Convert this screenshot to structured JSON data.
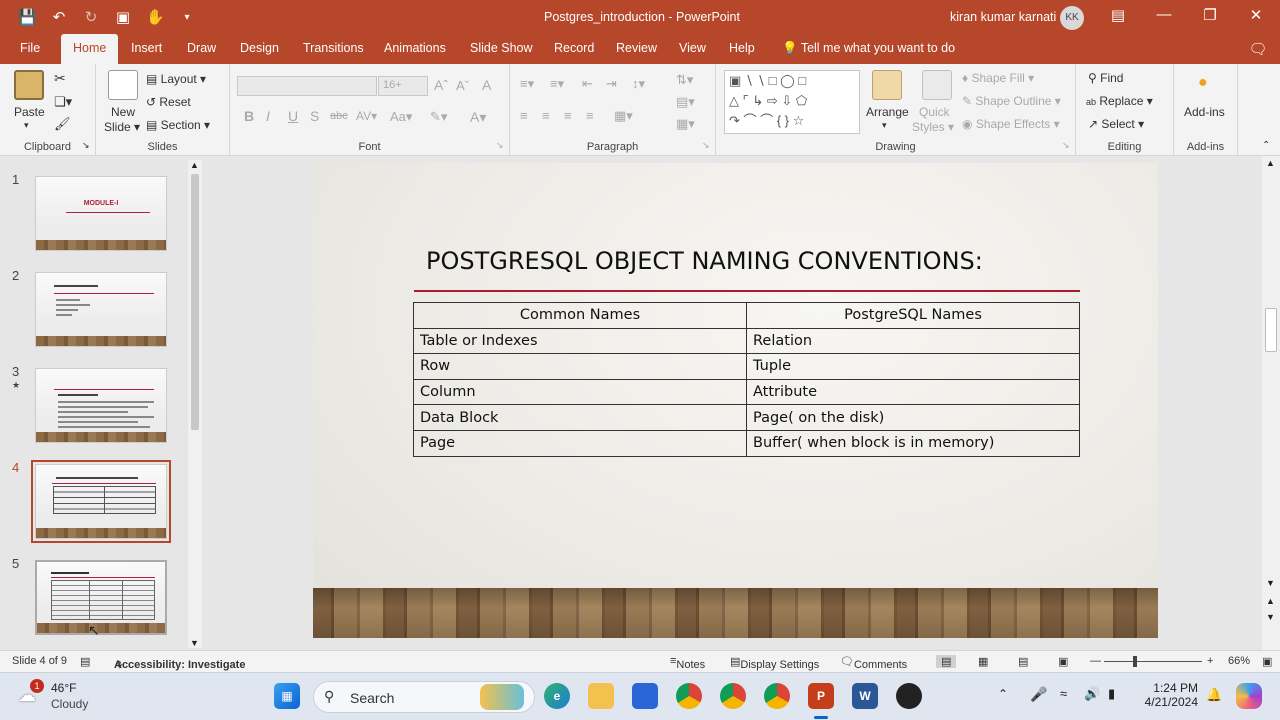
{
  "window": {
    "doc_title": "Postgres_introduction  -  PowerPoint",
    "user_name": "kiran kumar karnati",
    "user_initials": "KK"
  },
  "tabs": [
    "File",
    "Home",
    "Insert",
    "Draw",
    "Design",
    "Transitions",
    "Animations",
    "Slide Show",
    "Record",
    "Review",
    "View",
    "Help"
  ],
  "tell_me": "Tell me what you want to do",
  "ribbon": {
    "clipboard": {
      "paste": "Paste",
      "label": "Clipboard"
    },
    "slides": {
      "new_slide_1": "New",
      "new_slide_2": "Slide",
      "layout": "Layout",
      "reset": "Reset",
      "section": "Section",
      "label": "Slides"
    },
    "font": {
      "label": "Font",
      "size_placeholder": "16+"
    },
    "paragraph": {
      "label": "Paragraph"
    },
    "drawing": {
      "arrange": "Arrange",
      "quick_styles_1": "Quick",
      "quick_styles_2": "Styles",
      "shape_fill": "Shape Fill",
      "shape_outline": "Shape Outline",
      "shape_effects": "Shape Effects",
      "label": "Drawing"
    },
    "editing": {
      "find": "Find",
      "replace": "Replace",
      "select": "Select",
      "label": "Editing"
    },
    "addins": {
      "addins": "Add-ins",
      "label": "Add-ins"
    }
  },
  "thumbnails": [
    {
      "num": "1",
      "title": "MODULE-I"
    },
    {
      "num": "2",
      "title": "MODULE I OBJECTIVE"
    },
    {
      "num": "3",
      "title": "WHAT IS POSTGRESQL"
    },
    {
      "num": "4",
      "title": "POSTGRESQL OBJECT NAMING CONVENTIONS"
    },
    {
      "num": "5",
      "title": "POSTGRESQL LIMITS"
    }
  ],
  "slide": {
    "title": "POSTGRESQL OBJECT NAMING CONVENTIONS:",
    "headers": [
      "Common Names",
      "PostgreSQL Names"
    ],
    "rows": [
      [
        "Table or Indexes",
        "Relation"
      ],
      [
        "Row",
        "Tuple"
      ],
      [
        "Column",
        "Attribute"
      ],
      [
        "Data Block",
        "Page( on the disk)"
      ],
      [
        "Page",
        "Buffer( when block is in memory)"
      ]
    ]
  },
  "status": {
    "slide_count": "Slide 4 of 9",
    "accessibility": "Accessibility: Investigate",
    "notes": "Notes",
    "display_settings": "Display Settings",
    "comments": "Comments",
    "zoom": "66%"
  },
  "taskbar": {
    "temperature": "46°F",
    "weather": "Cloudy",
    "weather_badge": "1",
    "search_placeholder": "Search",
    "time": "1:24 PM",
    "date": "4/21/2024"
  },
  "colors": {
    "accent": "#b7472a",
    "slide_title_rule": "#a81e2f"
  }
}
